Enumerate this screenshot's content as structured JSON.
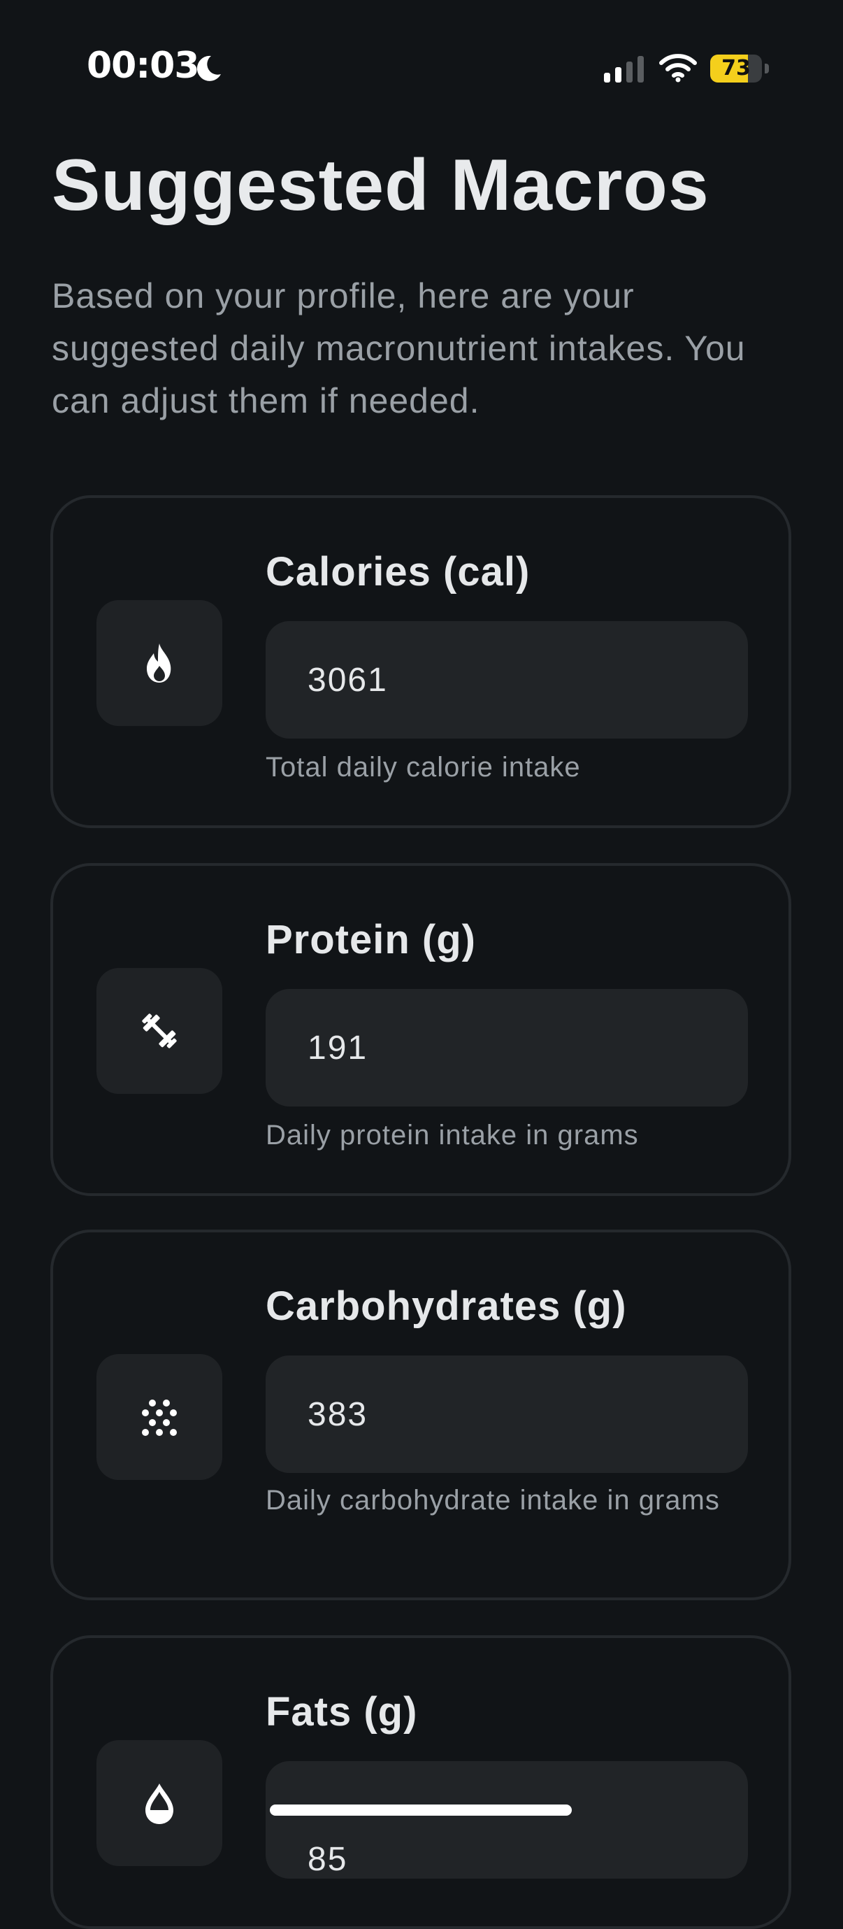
{
  "status_bar": {
    "time": "00:03",
    "battery_level": "73",
    "battery_fraction": 0.73,
    "icons": [
      "moon-icon",
      "signal-icon",
      "wifi-icon",
      "battery-icon"
    ]
  },
  "header": {
    "title": "Suggested Macros",
    "subtitle": "Based on your profile, here are your suggested daily macronutrient intakes. You can adjust them if needed."
  },
  "macros": [
    {
      "icon": "flame-icon",
      "label": "Calories (cal)",
      "value": "3061",
      "help": "Total daily calorie intake"
    },
    {
      "icon": "dumbbell-icon",
      "label": "Protein (g)",
      "value": "191",
      "help": "Daily protein intake in grams"
    },
    {
      "icon": "grain-icon",
      "label": "Carbohydrates (g)",
      "value": "383",
      "help": "Daily carbohydrate intake in grams"
    },
    {
      "icon": "drop-icon",
      "label": "Fats (g)",
      "value": "85",
      "help": ""
    }
  ],
  "colors": {
    "background": "#111417",
    "card_border": "#25292d",
    "input_bg": "#212427",
    "battery_yellow": "#f4cf1c"
  }
}
